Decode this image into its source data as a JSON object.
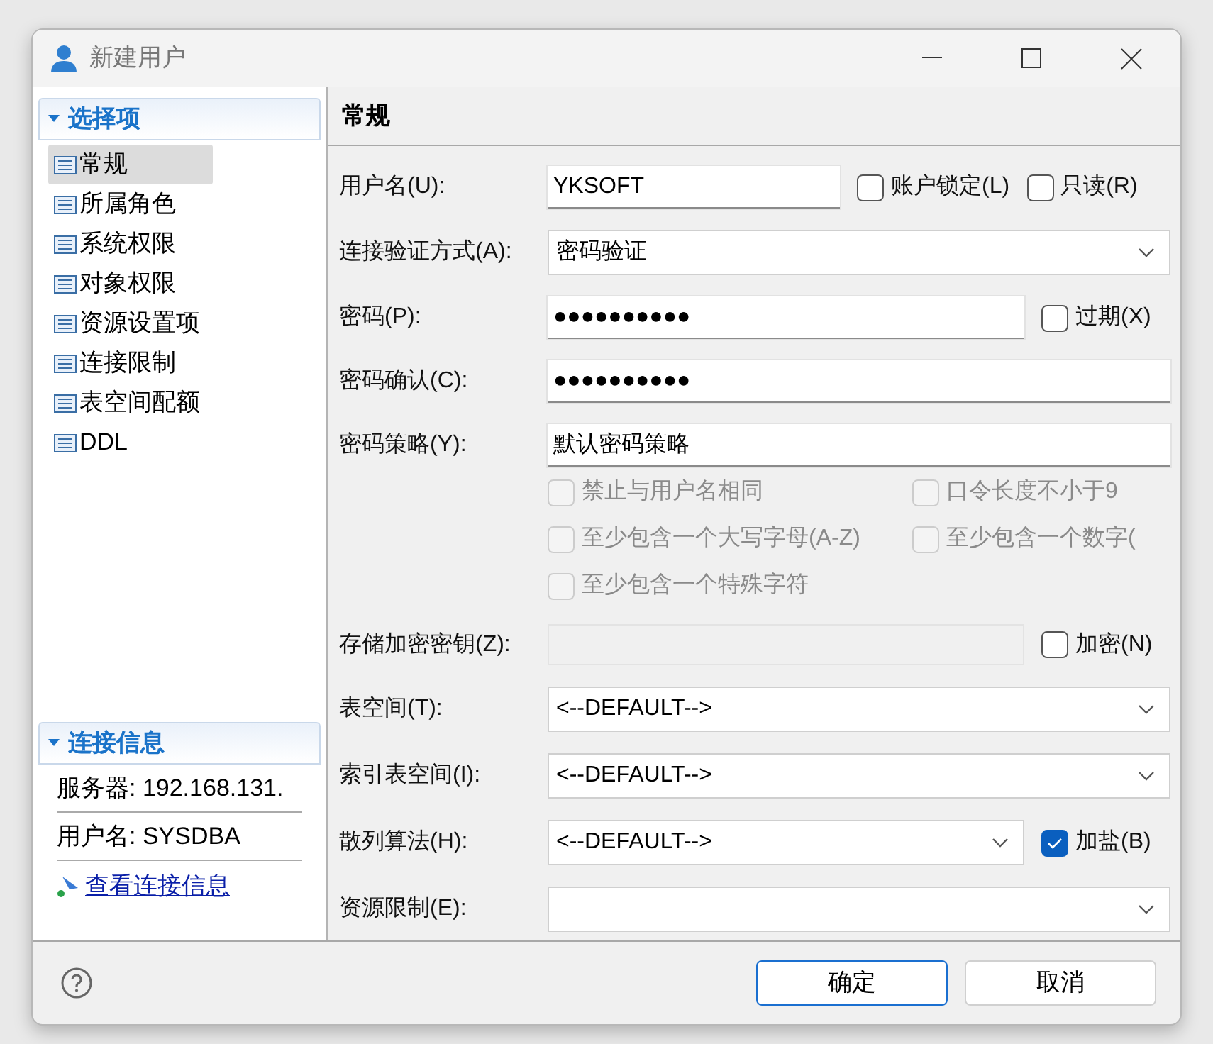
{
  "window": {
    "title": "新建用户"
  },
  "sidebar": {
    "title": "选择项",
    "expanded": true,
    "items": [
      {
        "label": "常规",
        "selected": true
      },
      {
        "label": "所属角色",
        "selected": false
      },
      {
        "label": "系统权限",
        "selected": false
      },
      {
        "label": "对象权限",
        "selected": false
      },
      {
        "label": "资源设置项",
        "selected": false
      },
      {
        "label": "连接限制",
        "selected": false
      },
      {
        "label": "表空间配额",
        "selected": false
      },
      {
        "label": "DDL",
        "selected": false
      }
    ]
  },
  "connection": {
    "title": "连接信息",
    "expanded": true,
    "rows": [
      "服务器: 192.168.131.",
      "用户名: SYSDBA"
    ],
    "link": "查看连接信息"
  },
  "form": {
    "heading": "常规",
    "fields": [
      {
        "kind": "text",
        "label": "用户名(U):",
        "value": "YKSOFT",
        "checks": [
          {
            "label": "账户锁定(L)",
            "checked": false
          },
          {
            "label": "只读(R)",
            "checked": false
          }
        ]
      },
      {
        "kind": "select",
        "label": "连接验证方式(A):",
        "value": "密码验证"
      },
      {
        "kind": "password",
        "label": "密码(P):",
        "value": "●●●●●●●●●●",
        "checks": [
          {
            "label": "过期(X)",
            "checked": false
          }
        ]
      },
      {
        "kind": "password",
        "label": "密码确认(C):",
        "value": "●●●●●●●●●●"
      },
      {
        "kind": "text",
        "label": "密码策略(Y):",
        "value": "默认密码策略",
        "options": [
          {
            "label": "禁止与用户名相同",
            "checked": false,
            "disabled": true
          },
          {
            "label": "口令长度不小于9",
            "checked": false,
            "disabled": true
          },
          {
            "label": "至少包含一个大写字母(A-Z)",
            "checked": false,
            "disabled": true
          },
          {
            "label": "至少包含一个数字(",
            "checked": false,
            "disabled": true
          },
          {
            "label": "至少包含一个特殊字符",
            "checked": false,
            "disabled": true
          }
        ]
      },
      {
        "kind": "disabled",
        "label": "存储加密密钥(Z):",
        "checks": [
          {
            "label": "加密(N)",
            "checked": false
          }
        ]
      },
      {
        "kind": "select",
        "label": "表空间(T):",
        "value": "<--DEFAULT-->"
      },
      {
        "kind": "select",
        "label": "索引表空间(I):",
        "value": "<--DEFAULT-->"
      },
      {
        "kind": "select",
        "label": "散列算法(H):",
        "value": "<--DEFAULT-->",
        "checks": [
          {
            "label": "加盐(B)",
            "checked": true
          }
        ]
      },
      {
        "kind": "select",
        "label": "资源限制(E):"
      }
    ]
  },
  "buttons": [
    {
      "label": "确定",
      "default": true
    },
    {
      "label": "取消",
      "default": false
    }
  ]
}
